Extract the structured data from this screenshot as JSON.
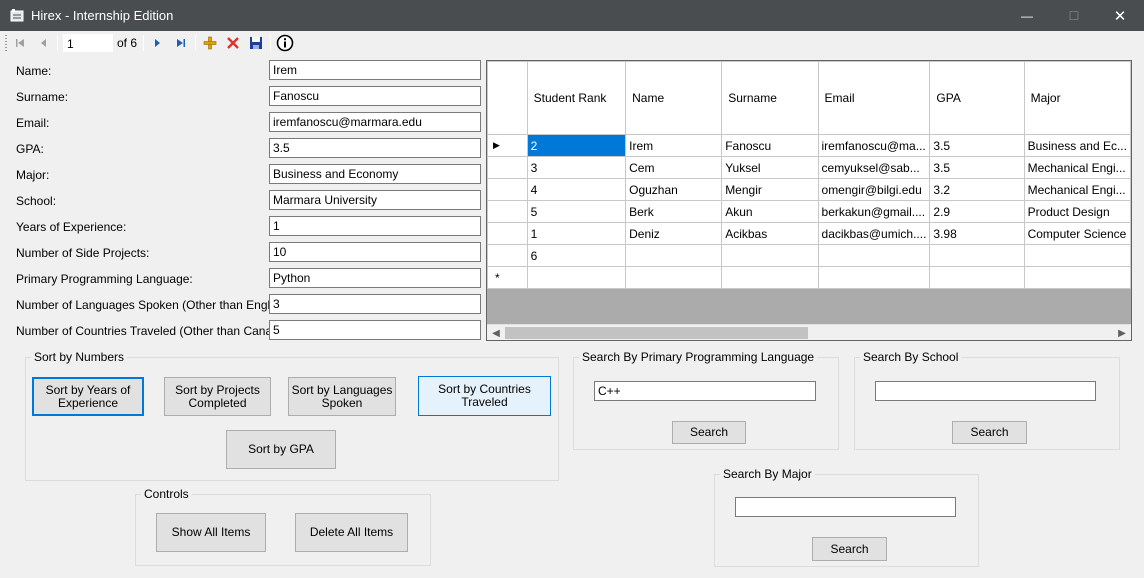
{
  "window": {
    "title": "Hirex - Internship Edition",
    "minimize": "—",
    "maximize": "☐",
    "close": "✕"
  },
  "navigator": {
    "position": "1",
    "count_label": "of 6"
  },
  "form": {
    "fields": [
      {
        "label": "Name:",
        "value": "Irem"
      },
      {
        "label": "Surname:",
        "value": "Fanoscu"
      },
      {
        "label": "Email:",
        "value": "iremfanoscu@marmara.edu"
      },
      {
        "label": "GPA:",
        "value": "3.5"
      },
      {
        "label": "Major:",
        "value": "Business and Economy"
      },
      {
        "label": "School:",
        "value": "Marmara University"
      },
      {
        "label": "Years of Experience:",
        "value": "1"
      },
      {
        "label": "Number of Side Projects:",
        "value": "10"
      },
      {
        "label": "Primary Programming Language:",
        "value": "Python"
      },
      {
        "label": "Number of Languages Spoken (Other than English):",
        "value": "3"
      },
      {
        "label": "Number of Countries Traveled (Other than Canada):",
        "value": "5"
      }
    ]
  },
  "grid": {
    "columns": [
      "Student Rank",
      "Name",
      "Surname",
      "Email",
      "GPA",
      "Major"
    ],
    "rows": [
      {
        "marker": "▶",
        "cells": [
          "2",
          "Irem",
          "Fanoscu",
          "iremfanoscu@ma...",
          "3.5",
          "Business and Ec..."
        ]
      },
      {
        "marker": "",
        "cells": [
          "3",
          "Cem",
          "Yuksel",
          "cemyuksel@sab...",
          "3.5",
          "Mechanical Engi..."
        ]
      },
      {
        "marker": "",
        "cells": [
          "4",
          "Oguzhan",
          "Mengir",
          "omengir@bilgi.edu",
          "3.2",
          "Mechanical Engi..."
        ]
      },
      {
        "marker": "",
        "cells": [
          "5",
          "Berk",
          "Akun",
          "berkakun@gmail....",
          "2.9",
          "Product Design"
        ]
      },
      {
        "marker": "",
        "cells": [
          "1",
          "Deniz",
          "Acikbas",
          "dacikbas@umich....",
          "3.98",
          "Computer Science"
        ]
      },
      {
        "marker": "",
        "cells": [
          "6",
          "",
          "",
          "",
          "",
          ""
        ]
      },
      {
        "marker": "*",
        "cells": [
          "",
          "",
          "",
          "",
          "",
          ""
        ]
      }
    ]
  },
  "sort": {
    "legend": "Sort by Numbers",
    "years": "Sort by Years of Experience",
    "projects": "Sort by Projects Completed",
    "languages": "Sort by Languages Spoken",
    "countries": "Sort by Countries Traveled",
    "gpa": "Sort by GPA"
  },
  "controls": {
    "legend": "Controls",
    "show_all": "Show All Items",
    "delete_all": "Delete All Items"
  },
  "search_lang": {
    "legend": "Search By Primary Programming Language",
    "value": "C++",
    "button": "Search"
  },
  "search_school": {
    "legend": "Search By School",
    "value": "",
    "button": "Search"
  },
  "search_major": {
    "legend": "Search By Major",
    "value": "",
    "button": "Search"
  }
}
